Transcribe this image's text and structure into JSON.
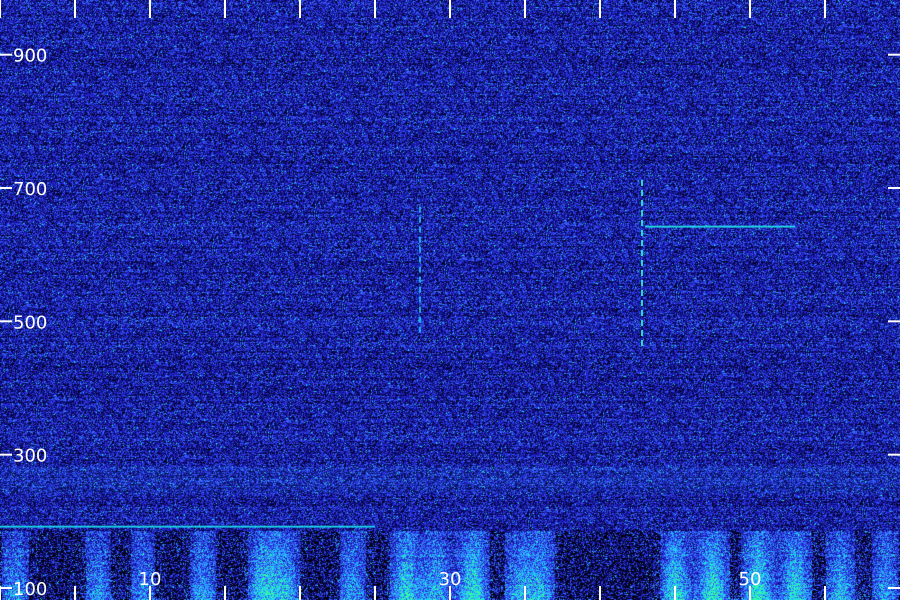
{
  "chart_data": {
    "type": "heatmap",
    "title": "",
    "xlabel": "",
    "ylabel": "",
    "colormap": [
      "#000000",
      "#0a0a78",
      "#2a2ae0",
      "#3a7bff",
      "#19d7ff",
      "#35ff9a"
    ],
    "background_color": "#13137f",
    "grid": false,
    "xlim": [
      0,
      60
    ],
    "ylim": [
      100,
      1000
    ],
    "x_ticks": [
      0,
      5,
      10,
      15,
      20,
      25,
      30,
      35,
      40,
      45,
      50,
      55
    ],
    "x_tick_labels": [
      {
        "value": 10,
        "label": "10"
      },
      {
        "value": 30,
        "label": "30"
      },
      {
        "value": 50,
        "label": "50"
      }
    ],
    "y_ticks": [
      100,
      300,
      500,
      700,
      900
    ],
    "y_tick_labels": [
      {
        "value": 100,
        "label": "100"
      },
      {
        "value": 300,
        "label": "300"
      },
      {
        "value": 500,
        "label": "500"
      },
      {
        "value": 700,
        "label": "700"
      },
      {
        "value": 900,
        "label": "900"
      }
    ],
    "features": [
      {
        "kind": "vertical-line",
        "x": 28,
        "y_from": 500,
        "y_to": 690,
        "intensity": 0.55
      },
      {
        "kind": "vertical-line",
        "x": 42.8,
        "y_from": 480,
        "y_to": 730,
        "intensity": 0.85
      },
      {
        "kind": "horizontal-line",
        "y": 660,
        "x_from": 43,
        "x_to": 53,
        "intensity": 0.75
      },
      {
        "kind": "horizontal-line",
        "y": 210,
        "x_from": 0,
        "x_to": 25,
        "intensity": 0.7
      },
      {
        "kind": "horizontal-band",
        "y_from": 260,
        "y_to": 300,
        "x_from": 0,
        "x_to": 60,
        "intensity": 0.45
      }
    ],
    "low_frequency_bursts": [
      {
        "x": 1,
        "intensity": 0.6
      },
      {
        "x": 6.5,
        "intensity": 0.55
      },
      {
        "x": 9.5,
        "intensity": 0.5
      },
      {
        "x": 13.5,
        "intensity": 0.6
      },
      {
        "x": 17.5,
        "intensity": 0.85
      },
      {
        "x": 19,
        "intensity": 0.7
      },
      {
        "x": 23.5,
        "intensity": 0.6
      },
      {
        "x": 27,
        "intensity": 0.9
      },
      {
        "x": 29,
        "intensity": 0.7
      },
      {
        "x": 31.5,
        "intensity": 1.0
      },
      {
        "x": 34.5,
        "intensity": 0.6
      },
      {
        "x": 36,
        "intensity": 0.7
      },
      {
        "x": 45,
        "intensity": 0.9
      },
      {
        "x": 47.5,
        "intensity": 1.0
      },
      {
        "x": 50.5,
        "intensity": 1.0
      },
      {
        "x": 53,
        "intensity": 0.9
      },
      {
        "x": 56,
        "intensity": 0.7
      },
      {
        "x": 59,
        "intensity": 0.6
      }
    ]
  }
}
